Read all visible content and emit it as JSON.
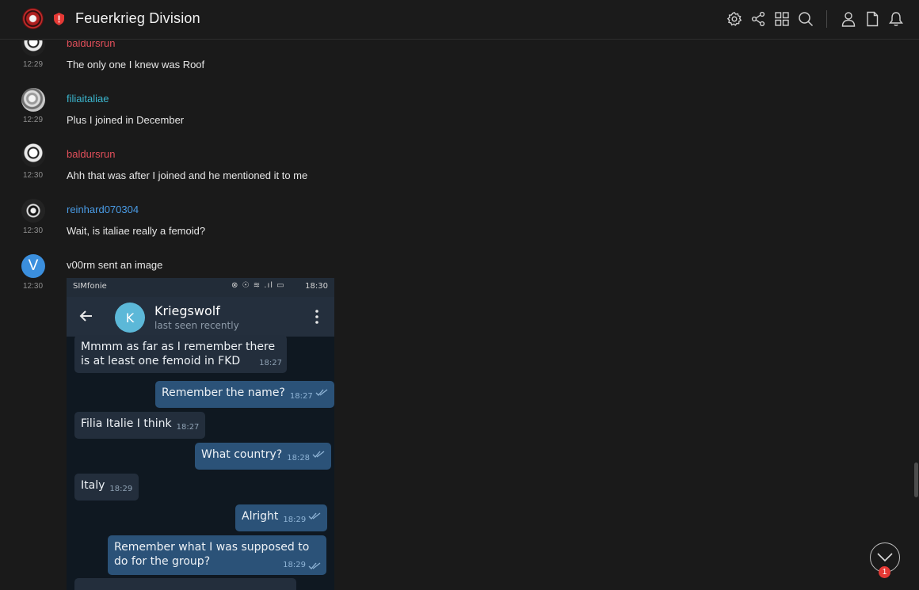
{
  "header": {
    "title": "Feuerkrieg Division",
    "toolbar_icons": [
      "gear-icon",
      "share-icon",
      "grid-icon",
      "search-icon",
      "user-icon",
      "document-icon",
      "bell-icon"
    ],
    "accent_color": "#e53935"
  },
  "messages": [
    {
      "author": "baldursrun",
      "time": "12:29",
      "text": "The only one I knew was Roof",
      "avatar": "skull"
    },
    {
      "author": "filiaitaliae",
      "time": "12:29",
      "text": "Plus I joined in December",
      "avatar": "statue"
    },
    {
      "author": "baldursrun",
      "time": "12:30",
      "text": "Ahh that was after I joined and he mentioned it to me",
      "avatar": "skull"
    },
    {
      "author": "reinhard070304",
      "time": "12:30",
      "text": "Wait, is italiae really a femoid?",
      "avatar": "flag"
    },
    {
      "author": "v00rm",
      "time": "12:30",
      "text": "v00rm sent an image",
      "avatar_letter": "V"
    }
  ],
  "image": {
    "status_bar": {
      "carrier": "SIMfonie",
      "time": "18:30",
      "icons": "⊗ ☉ ≋ .ıl ▭"
    },
    "chat": {
      "avatar_letter": "K",
      "name": "Kriegswolf",
      "status": "last seen recently"
    },
    "bubbles": [
      {
        "dir": "in",
        "text": "Mmmm as far as I remember there is at least one femoid in FKD",
        "time": "18:27"
      },
      {
        "dir": "out",
        "text": "Remember the name?",
        "time": "18:27"
      },
      {
        "dir": "in",
        "text": "Filia Italie I think",
        "time": "18:27"
      },
      {
        "dir": "out",
        "text": "What country?",
        "time": "18:28"
      },
      {
        "dir": "in",
        "text": "Italy",
        "time": "18:29"
      },
      {
        "dir": "out",
        "text": "Alright",
        "time": "18:29"
      },
      {
        "dir": "out",
        "text": "Remember what I was supposed to do for the group?",
        "time": "18:29"
      }
    ]
  },
  "scroll_button": {
    "badge": "1"
  }
}
